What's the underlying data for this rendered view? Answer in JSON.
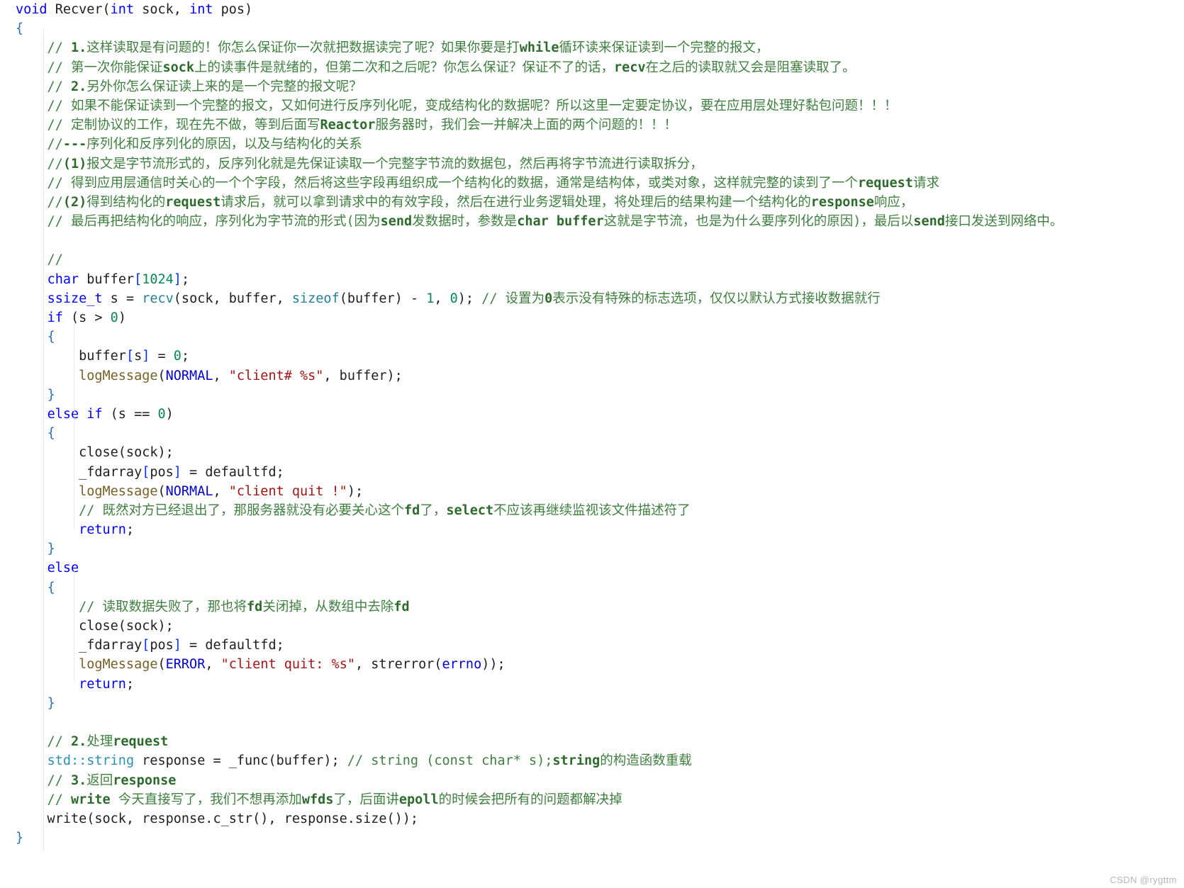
{
  "editor": {
    "language": "cpp",
    "background": "#ffffff",
    "font_size_px": 18.5,
    "line_height_px": 27.2,
    "colors": {
      "keyword": "#0000ff",
      "comment": "#3f7f3f",
      "string": "#a31515",
      "number": "#098658",
      "function": "#795e26",
      "library_call": "#267f99",
      "brace": "#2e6fbf",
      "bracket": "#0431fa",
      "macro": "#0000d0",
      "type": "#2b91af",
      "plain_text": "#1f1f1f",
      "watermark": "#b5b5b5"
    }
  },
  "watermark": {
    "text": "CSDN @rygttm"
  },
  "code_lines": [
    {
      "id": "line-1",
      "tokens": [
        {
          "c": "t-kw",
          "t": "void"
        },
        {
          "c": "t-plain",
          "t": " "
        },
        {
          "c": "t-plain",
          "t": "Recver"
        },
        {
          "c": "t-plain",
          "t": "("
        },
        {
          "c": "t-kw",
          "t": "int"
        },
        {
          "c": "t-plain",
          "t": " sock, "
        },
        {
          "c": "t-kw",
          "t": "int"
        },
        {
          "c": "t-plain",
          "t": " pos)"
        }
      ]
    },
    {
      "id": "line-2",
      "tokens": [
        {
          "c": "t-brace",
          "t": "{"
        }
      ]
    },
    {
      "id": "line-3",
      "tokens": [
        {
          "c": "t-cmt",
          "t": "    // "
        },
        {
          "c": "t-cmt-b",
          "t": "1."
        },
        {
          "c": "t-cmt",
          "t": "这样读取是有问题的！你怎么保证你一次就把数据读完了呢？如果你要是打"
        },
        {
          "c": "t-cmt-b",
          "t": "while"
        },
        {
          "c": "t-cmt",
          "t": "循环读来保证读到一个完整的报文，"
        }
      ]
    },
    {
      "id": "line-4",
      "tokens": [
        {
          "c": "t-cmt",
          "t": "    // 第一次你能保证"
        },
        {
          "c": "t-cmt-b",
          "t": "sock"
        },
        {
          "c": "t-cmt",
          "t": "上的读事件是就绪的，但第二次和之后呢？你怎么保证？保证不了的话，"
        },
        {
          "c": "t-cmt-b",
          "t": "recv"
        },
        {
          "c": "t-cmt",
          "t": "在之后的读取就又会是阻塞读取了。"
        }
      ]
    },
    {
      "id": "line-5",
      "tokens": [
        {
          "c": "t-cmt",
          "t": "    // "
        },
        {
          "c": "t-cmt-b",
          "t": "2."
        },
        {
          "c": "t-cmt",
          "t": "另外你怎么保证读上来的是一个完整的报文呢？"
        }
      ]
    },
    {
      "id": "line-6",
      "tokens": [
        {
          "c": "t-cmt",
          "t": "    // 如果不能保证读到一个完整的报文，又如何进行反序列化呢，变成结构化的数据呢？所以这里一定要定协议，要在应用层处理好黏包问题！！！"
        }
      ]
    },
    {
      "id": "line-7",
      "tokens": [
        {
          "c": "t-cmt",
          "t": "    // 定制协议的工作，现在先不做，等到后面写"
        },
        {
          "c": "t-cmt-b",
          "t": "Reactor"
        },
        {
          "c": "t-cmt",
          "t": "服务器时，我们会一并解决上面的两个问题的！！！"
        }
      ]
    },
    {
      "id": "line-8",
      "tokens": [
        {
          "c": "t-cmt",
          "t": "    //"
        },
        {
          "c": "t-cmt-b",
          "t": "---"
        },
        {
          "c": "t-cmt",
          "t": "序列化和反序列化的原因，以及与结构化的关系"
        }
      ]
    },
    {
      "id": "line-9",
      "tokens": [
        {
          "c": "t-cmt",
          "t": "    //"
        },
        {
          "c": "t-cmt-b",
          "t": "(1)"
        },
        {
          "c": "t-cmt",
          "t": "报文是字节流形式的，反序列化就是先保证读取一个完整字节流的数据包，然后再将字节流进行读取拆分，"
        }
      ]
    },
    {
      "id": "line-10",
      "tokens": [
        {
          "c": "t-cmt",
          "t": "    // 得到应用层通信时关心的一个个字段，然后将这些字段再组织成一个结构化的数据，通常是结构体，或类对象，这样就完整的读到了一个"
        },
        {
          "c": "t-cmt-b",
          "t": "request"
        },
        {
          "c": "t-cmt",
          "t": "请求"
        }
      ]
    },
    {
      "id": "line-11",
      "tokens": [
        {
          "c": "t-cmt",
          "t": "    //"
        },
        {
          "c": "t-cmt-b",
          "t": "(2)"
        },
        {
          "c": "t-cmt",
          "t": "得到结构化的"
        },
        {
          "c": "t-cmt-b",
          "t": "request"
        },
        {
          "c": "t-cmt",
          "t": "请求后，就可以拿到请求中的有效字段，然后在进行业务逻辑处理，将处理后的结果构建一个结构化的"
        },
        {
          "c": "t-cmt-b",
          "t": "response"
        },
        {
          "c": "t-cmt",
          "t": "响应，"
        }
      ]
    },
    {
      "id": "line-12",
      "tokens": [
        {
          "c": "t-cmt",
          "t": "    // 最后再把结构化的响应，序列化为字节流的形式(因为"
        },
        {
          "c": "t-cmt-b",
          "t": "send"
        },
        {
          "c": "t-cmt",
          "t": "发数据时，参数是"
        },
        {
          "c": "t-cmt-b",
          "t": "char buffer"
        },
        {
          "c": "t-cmt",
          "t": "这就是字节流，也是为什么要序列化的原因)，最后以"
        },
        {
          "c": "t-cmt-b",
          "t": "send"
        },
        {
          "c": "t-cmt",
          "t": "接口发送到网络中。"
        }
      ]
    },
    {
      "id": "line-13",
      "tokens": []
    },
    {
      "id": "line-14",
      "tokens": [
        {
          "c": "t-cmt",
          "t": "    //"
        }
      ]
    },
    {
      "id": "line-15",
      "tokens": [
        {
          "c": "t-plain",
          "t": "    "
        },
        {
          "c": "t-kw",
          "t": "char"
        },
        {
          "c": "t-plain",
          "t": " buffer"
        },
        {
          "c": "t-brk",
          "t": "["
        },
        {
          "c": "t-num",
          "t": "1024"
        },
        {
          "c": "t-brk",
          "t": "]"
        },
        {
          "c": "t-plain",
          "t": ";"
        }
      ]
    },
    {
      "id": "line-16",
      "tokens": [
        {
          "c": "t-plain",
          "t": "    "
        },
        {
          "c": "t-kw",
          "t": "ssize_t"
        },
        {
          "c": "t-plain",
          "t": " s = "
        },
        {
          "c": "t-call",
          "t": "recv"
        },
        {
          "c": "t-plain",
          "t": "(sock, buffer, "
        },
        {
          "c": "t-call",
          "t": "sizeof"
        },
        {
          "c": "t-plain",
          "t": "(buffer) - "
        },
        {
          "c": "t-num",
          "t": "1"
        },
        {
          "c": "t-plain",
          "t": ", "
        },
        {
          "c": "t-num",
          "t": "0"
        },
        {
          "c": "t-plain",
          "t": "); "
        },
        {
          "c": "t-cmt",
          "t": "// 设置为"
        },
        {
          "c": "t-cmt-b",
          "t": "0"
        },
        {
          "c": "t-cmt",
          "t": "表示没有特殊的标志选项，仅仅以默认方式接收数据就行"
        }
      ]
    },
    {
      "id": "line-17",
      "tokens": [
        {
          "c": "t-plain",
          "t": "    "
        },
        {
          "c": "t-kw",
          "t": "if"
        },
        {
          "c": "t-plain",
          "t": " (s > "
        },
        {
          "c": "t-num",
          "t": "0"
        },
        {
          "c": "t-plain",
          "t": ")"
        }
      ]
    },
    {
      "id": "line-18",
      "tokens": [
        {
          "c": "t-plain",
          "t": "    "
        },
        {
          "c": "t-brace",
          "t": "{"
        }
      ]
    },
    {
      "id": "line-19",
      "tokens": [
        {
          "c": "t-plain",
          "t": "        buffer"
        },
        {
          "c": "t-brk",
          "t": "["
        },
        {
          "c": "t-plain",
          "t": "s"
        },
        {
          "c": "t-brk",
          "t": "]"
        },
        {
          "c": "t-plain",
          "t": " = "
        },
        {
          "c": "t-num",
          "t": "0"
        },
        {
          "c": "t-plain",
          "t": ";"
        }
      ]
    },
    {
      "id": "line-20",
      "tokens": [
        {
          "c": "t-plain",
          "t": "        "
        },
        {
          "c": "t-fn",
          "t": "logMessage"
        },
        {
          "c": "t-plain",
          "t": "("
        },
        {
          "c": "t-macro",
          "t": "NORMAL"
        },
        {
          "c": "t-plain",
          "t": ", "
        },
        {
          "c": "t-str",
          "t": "\"client# %s\""
        },
        {
          "c": "t-plain",
          "t": ", buffer);"
        }
      ]
    },
    {
      "id": "line-21",
      "tokens": [
        {
          "c": "t-plain",
          "t": "    "
        },
        {
          "c": "t-brace",
          "t": "}"
        }
      ]
    },
    {
      "id": "line-22",
      "tokens": [
        {
          "c": "t-plain",
          "t": "    "
        },
        {
          "c": "t-kw",
          "t": "else if"
        },
        {
          "c": "t-plain",
          "t": " (s == "
        },
        {
          "c": "t-num",
          "t": "0"
        },
        {
          "c": "t-plain",
          "t": ")"
        }
      ]
    },
    {
      "id": "line-23",
      "tokens": [
        {
          "c": "t-plain",
          "t": "    "
        },
        {
          "c": "t-brace",
          "t": "{"
        }
      ]
    },
    {
      "id": "line-24",
      "tokens": [
        {
          "c": "t-plain",
          "t": "        "
        },
        {
          "c": "t-plain",
          "t": "close(sock);"
        }
      ]
    },
    {
      "id": "line-25",
      "tokens": [
        {
          "c": "t-plain",
          "t": "        _fdarray"
        },
        {
          "c": "t-brk",
          "t": "["
        },
        {
          "c": "t-plain",
          "t": "pos"
        },
        {
          "c": "t-brk",
          "t": "]"
        },
        {
          "c": "t-plain",
          "t": " = defaultfd;"
        }
      ]
    },
    {
      "id": "line-26",
      "tokens": [
        {
          "c": "t-plain",
          "t": "        "
        },
        {
          "c": "t-fn",
          "t": "logMessage"
        },
        {
          "c": "t-plain",
          "t": "("
        },
        {
          "c": "t-macro",
          "t": "NORMAL"
        },
        {
          "c": "t-plain",
          "t": ", "
        },
        {
          "c": "t-str",
          "t": "\"client quit !\""
        },
        {
          "c": "t-plain",
          "t": ");"
        }
      ]
    },
    {
      "id": "line-27",
      "tokens": [
        {
          "c": "t-cmt",
          "t": "        // 既然对方已经退出了，那服务器就没有必要关心这个"
        },
        {
          "c": "t-cmt-b",
          "t": "fd"
        },
        {
          "c": "t-cmt",
          "t": "了，"
        },
        {
          "c": "t-cmt-b",
          "t": "select"
        },
        {
          "c": "t-cmt",
          "t": "不应该再继续监视该文件描述符了"
        }
      ]
    },
    {
      "id": "line-28",
      "tokens": [
        {
          "c": "t-plain",
          "t": "        "
        },
        {
          "c": "t-kw",
          "t": "return"
        },
        {
          "c": "t-plain",
          "t": ";"
        }
      ]
    },
    {
      "id": "line-29",
      "tokens": [
        {
          "c": "t-plain",
          "t": "    "
        },
        {
          "c": "t-brace",
          "t": "}"
        }
      ]
    },
    {
      "id": "line-30",
      "tokens": [
        {
          "c": "t-plain",
          "t": "    "
        },
        {
          "c": "t-kw",
          "t": "else"
        }
      ]
    },
    {
      "id": "line-31",
      "tokens": [
        {
          "c": "t-plain",
          "t": "    "
        },
        {
          "c": "t-brace",
          "t": "{"
        }
      ]
    },
    {
      "id": "line-32",
      "tokens": [
        {
          "c": "t-cmt",
          "t": "        // 读取数据失败了，那也将"
        },
        {
          "c": "t-cmt-b",
          "t": "fd"
        },
        {
          "c": "t-cmt",
          "t": "关闭掉，从数组中去除"
        },
        {
          "c": "t-cmt-b",
          "t": "fd"
        }
      ]
    },
    {
      "id": "line-33",
      "tokens": [
        {
          "c": "t-plain",
          "t": "        close(sock);"
        }
      ]
    },
    {
      "id": "line-34",
      "tokens": [
        {
          "c": "t-plain",
          "t": "        _fdarray"
        },
        {
          "c": "t-brk",
          "t": "["
        },
        {
          "c": "t-plain",
          "t": "pos"
        },
        {
          "c": "t-brk",
          "t": "]"
        },
        {
          "c": "t-plain",
          "t": " = defaultfd;"
        }
      ]
    },
    {
      "id": "line-35",
      "tokens": [
        {
          "c": "t-plain",
          "t": "        "
        },
        {
          "c": "t-fn",
          "t": "logMessage"
        },
        {
          "c": "t-plain",
          "t": "("
        },
        {
          "c": "t-macro",
          "t": "ERROR"
        },
        {
          "c": "t-plain",
          "t": ", "
        },
        {
          "c": "t-str",
          "t": "\"client quit: %s\""
        },
        {
          "c": "t-plain",
          "t": ", strerror("
        },
        {
          "c": "t-macro",
          "t": "errno"
        },
        {
          "c": "t-plain",
          "t": "));"
        }
      ]
    },
    {
      "id": "line-36",
      "tokens": [
        {
          "c": "t-plain",
          "t": "        "
        },
        {
          "c": "t-kw",
          "t": "return"
        },
        {
          "c": "t-plain",
          "t": ";"
        }
      ]
    },
    {
      "id": "line-37",
      "tokens": [
        {
          "c": "t-plain",
          "t": "    "
        },
        {
          "c": "t-brace",
          "t": "}"
        }
      ]
    },
    {
      "id": "line-38",
      "tokens": []
    },
    {
      "id": "line-39",
      "tokens": [
        {
          "c": "t-cmt",
          "t": "    // "
        },
        {
          "c": "t-cmt-b",
          "t": "2."
        },
        {
          "c": "t-cmt",
          "t": "处理"
        },
        {
          "c": "t-cmt-b",
          "t": "request"
        }
      ]
    },
    {
      "id": "line-40",
      "tokens": [
        {
          "c": "t-plain",
          "t": "    "
        },
        {
          "c": "t-type",
          "t": "std::string"
        },
        {
          "c": "t-plain",
          "t": " response = _func(buffer); "
        },
        {
          "c": "t-cmt",
          "t": "// string (const char* s);"
        },
        {
          "c": "t-cmt-b",
          "t": "string"
        },
        {
          "c": "t-cmt",
          "t": "的构造函数重载"
        }
      ]
    },
    {
      "id": "line-41",
      "tokens": [
        {
          "c": "t-cmt",
          "t": "    // "
        },
        {
          "c": "t-cmt-b",
          "t": "3."
        },
        {
          "c": "t-cmt",
          "t": "返回"
        },
        {
          "c": "t-cmt-b",
          "t": "response"
        }
      ]
    },
    {
      "id": "line-42",
      "tokens": [
        {
          "c": "t-cmt",
          "t": "    // "
        },
        {
          "c": "t-cmt-b",
          "t": "write"
        },
        {
          "c": "t-cmt",
          "t": " 今天直接写了，我们不想再添加"
        },
        {
          "c": "t-cmt-b",
          "t": "wfds"
        },
        {
          "c": "t-cmt",
          "t": "了，后面讲"
        },
        {
          "c": "t-cmt-b",
          "t": "epoll"
        },
        {
          "c": "t-cmt",
          "t": "的时候会把所有的问题都解决掉"
        }
      ]
    },
    {
      "id": "line-43",
      "tokens": [
        {
          "c": "t-plain",
          "t": "    write(sock, response.c_str(), response.size());"
        }
      ]
    },
    {
      "id": "line-44",
      "tokens": [
        {
          "c": "t-brace",
          "t": "}"
        }
      ]
    }
  ]
}
